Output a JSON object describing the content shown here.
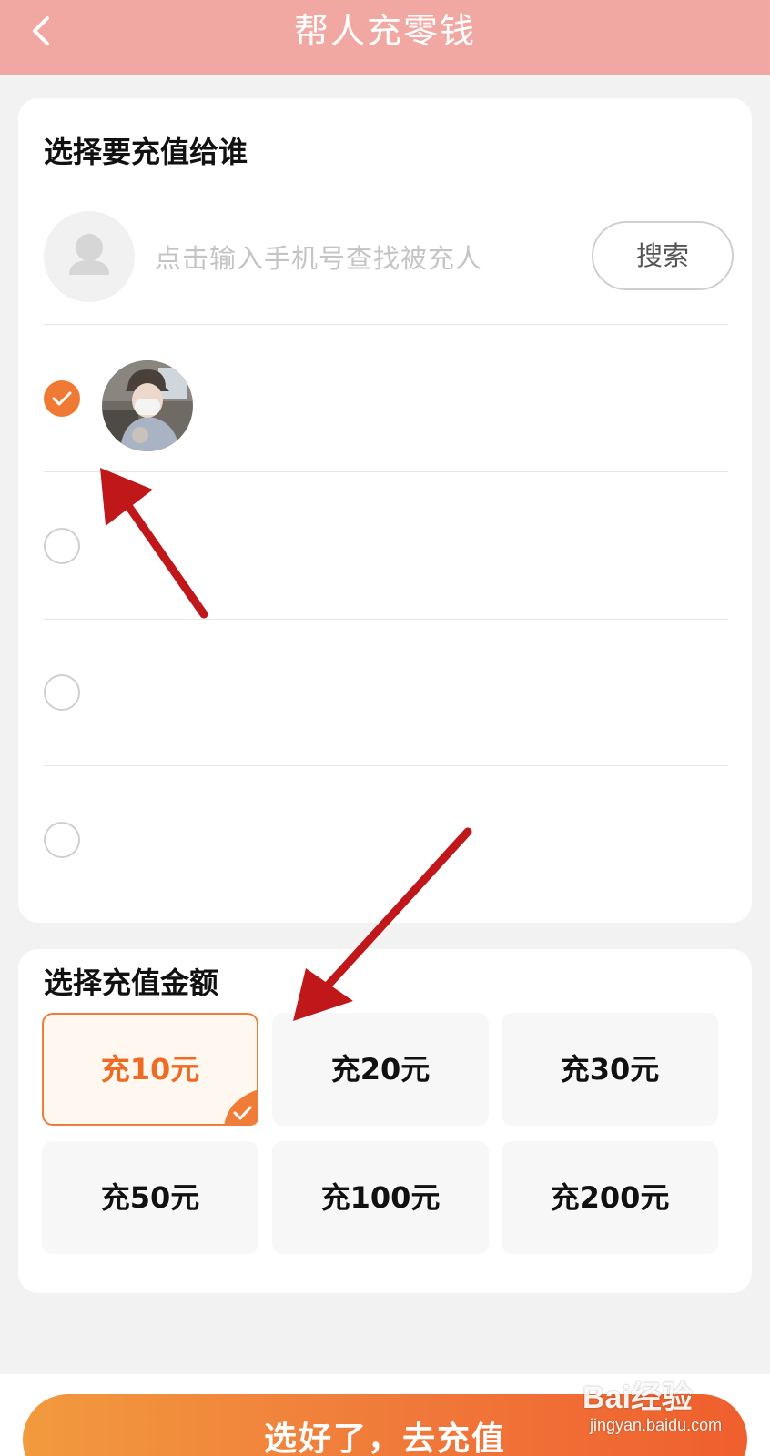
{
  "header": {
    "title": "帮人充零钱",
    "back_icon": "chevron-left-icon"
  },
  "recipient": {
    "section_title": "选择要充值给谁",
    "search_placeholder": "点击输入手机号查找被充人",
    "search_button": "搜索",
    "contacts": [
      {
        "checked": true,
        "has_avatar": true
      },
      {
        "checked": false,
        "has_avatar": false
      },
      {
        "checked": false,
        "has_avatar": false
      },
      {
        "checked": false,
        "has_avatar": false
      }
    ]
  },
  "amount": {
    "section_title": "选择充值金额",
    "options": [
      {
        "label": "充10元",
        "selected": true
      },
      {
        "label": "充20元",
        "selected": false
      },
      {
        "label": "充30元",
        "selected": false
      },
      {
        "label": "充50元",
        "selected": false
      },
      {
        "label": "充100元",
        "selected": false
      },
      {
        "label": "充200元",
        "selected": false
      }
    ]
  },
  "submit_button": "选好了，去充值",
  "watermark": {
    "top": "Bai经验",
    "bottom": "jingyan.baidu.com"
  },
  "colors": {
    "header": "#f2a8a2",
    "accent": "#f07a34",
    "annotation_arrow": "#c0171b"
  }
}
